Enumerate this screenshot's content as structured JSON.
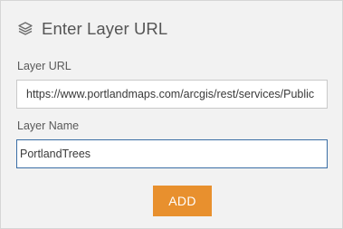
{
  "header": {
    "title": "Enter Layer URL",
    "icon": "layers-icon"
  },
  "form": {
    "url_label": "Layer URL",
    "url_value": "https://www.portlandmaps.com/arcgis/rest/services/Public",
    "name_label": "Layer Name",
    "name_value": "PortlandTrees"
  },
  "actions": {
    "add_label": "ADD",
    "add_color": "#e8902e"
  }
}
